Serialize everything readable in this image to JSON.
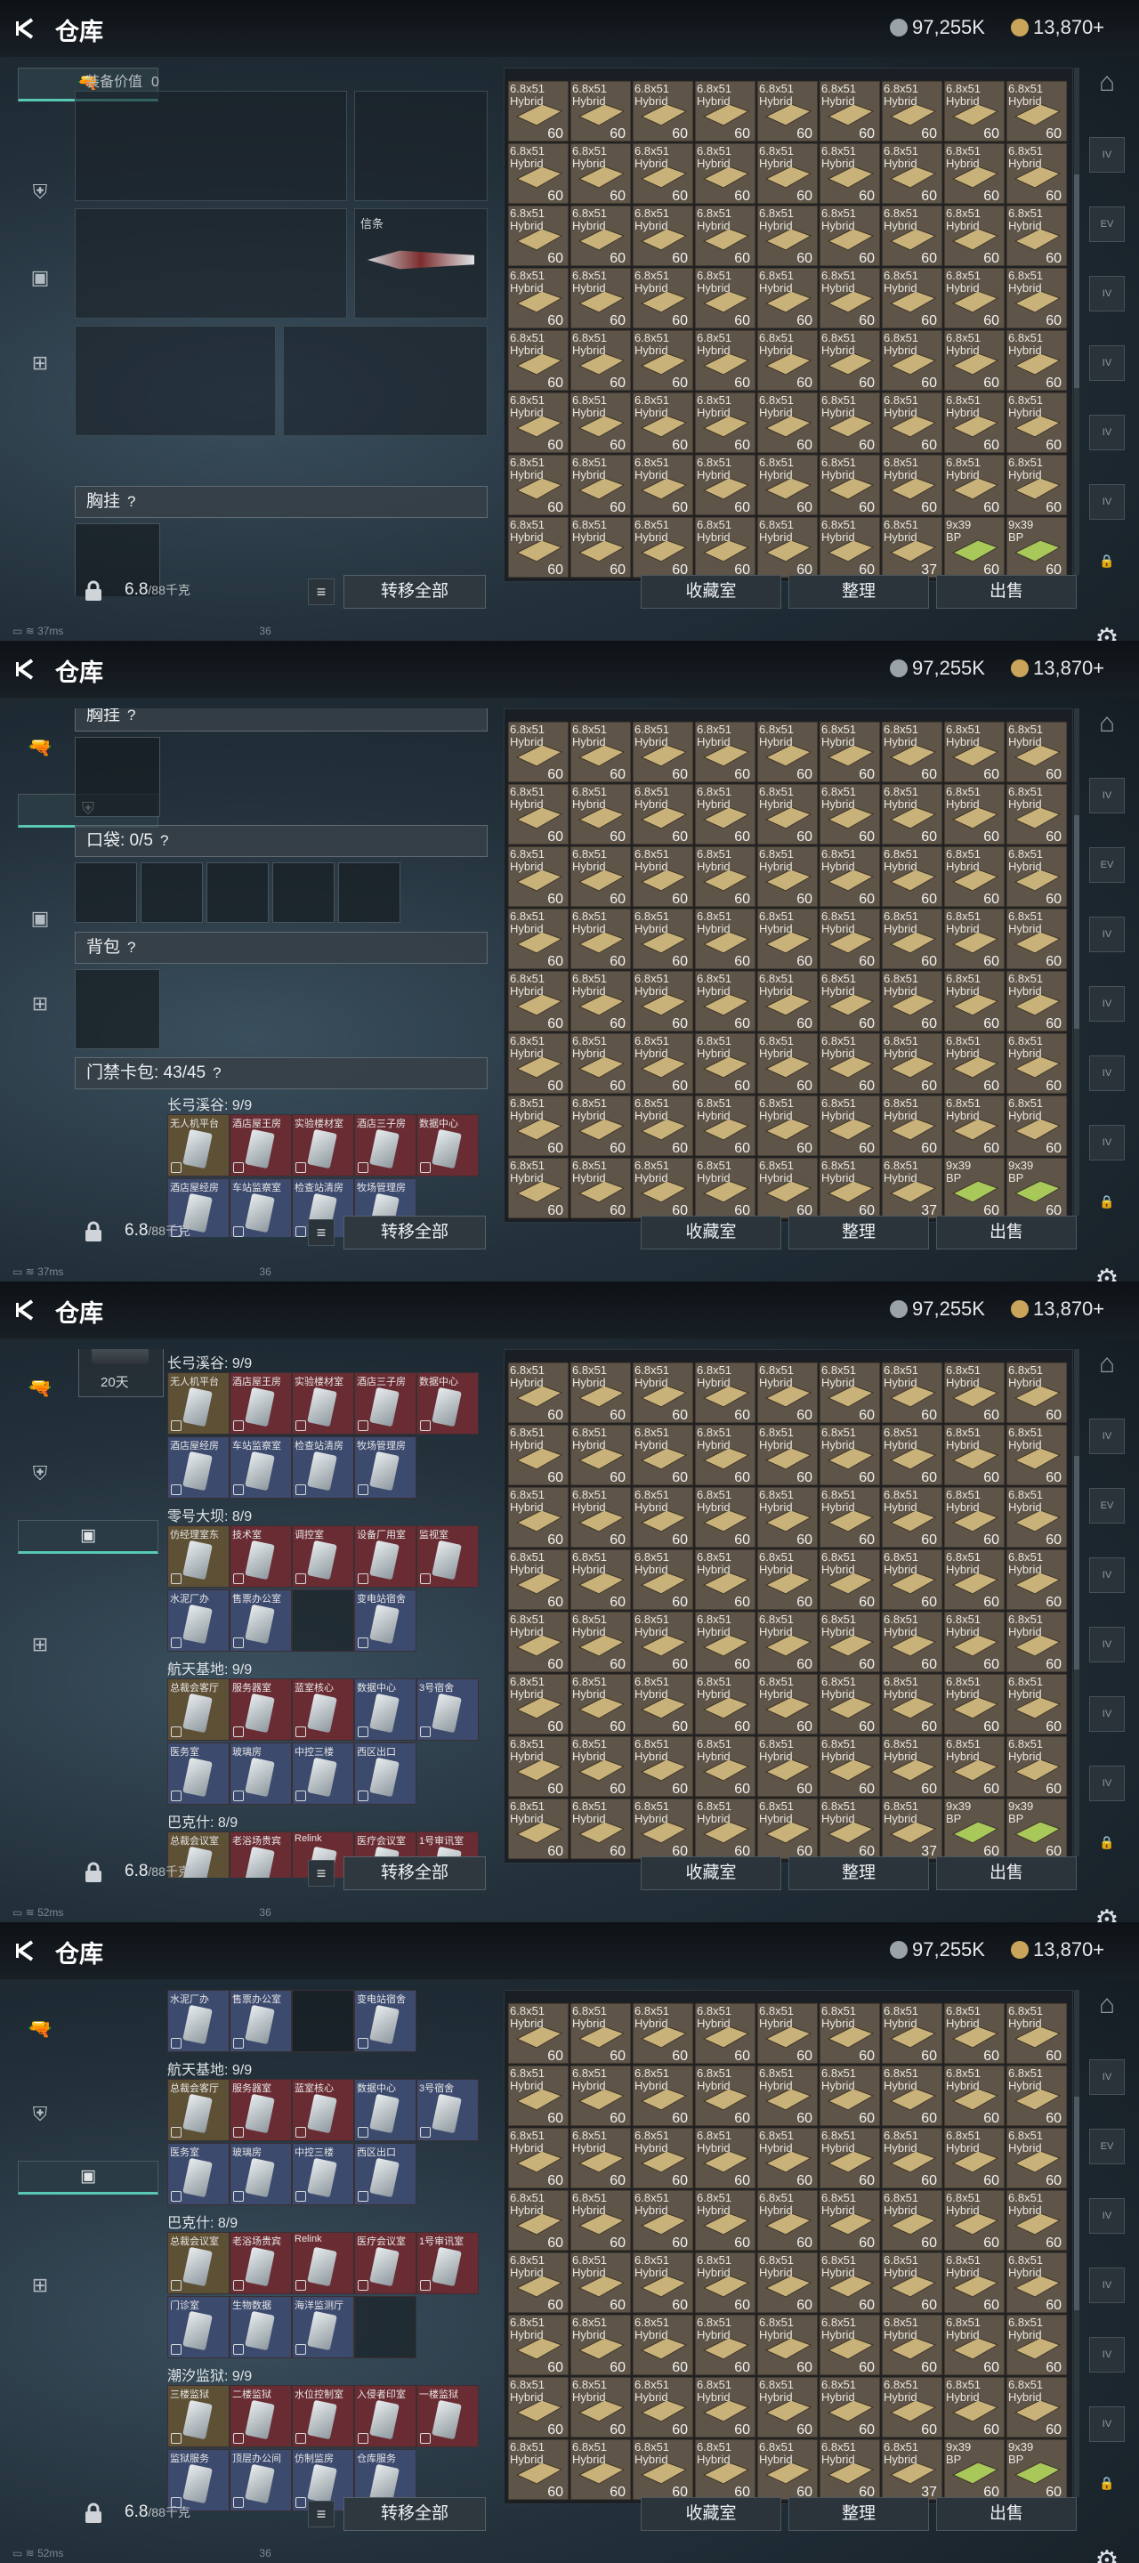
{
  "title": "仓库",
  "currency": {
    "silver": "97,255K",
    "gold": "13,870+"
  },
  "left_nav": [
    "weapon",
    "armor",
    "gear",
    "case"
  ],
  "right_nav": [
    "stash-main",
    "tab-1",
    "tab-2",
    "tab-3",
    "tab-4",
    "tab-5",
    "tab-6",
    "lock",
    "settings"
  ],
  "right_tab_labels": [
    "IV",
    "EV",
    "IV",
    "IV",
    "IV",
    "IV"
  ],
  "equip": {
    "value_label": "装备价值",
    "value": "0",
    "melee_name": "信条"
  },
  "sections": {
    "chest": "胸挂",
    "pocket": "口袋: 0/5",
    "backpack": "背包",
    "keycase": "门禁卡包: 43/45",
    "help": "?"
  },
  "keycase": {
    "duration": "20天"
  },
  "keygroups": [
    {
      "name": "长弓溪谷: 9/9",
      "keys": [
        {
          "n": "无人机平台",
          "c": "gold"
        },
        {
          "n": "酒店屋王房",
          "c": "red"
        },
        {
          "n": "实验楼材室",
          "c": "red"
        },
        {
          "n": "酒店三子房",
          "c": "red"
        },
        {
          "n": "数据中心",
          "c": "red"
        },
        {
          "n": "酒店屋经房",
          "c": "blu"
        },
        {
          "n": "车站监察室",
          "c": "blu"
        },
        {
          "n": "检查站清房",
          "c": "blu"
        },
        {
          "n": "牧场管理房",
          "c": "blu"
        }
      ]
    },
    {
      "name": "零号大坝: 8/9",
      "keys": [
        {
          "n": "仿经理室东",
          "c": "gold"
        },
        {
          "n": "技术室",
          "c": "red"
        },
        {
          "n": "调控室",
          "c": "red"
        },
        {
          "n": "设备厂用室",
          "c": "red"
        },
        {
          "n": "监视室",
          "c": "red"
        },
        {
          "n": "水泥厂办",
          "c": "blu"
        },
        {
          "n": "售票办公室",
          "c": "blu"
        },
        {
          "n": "",
          "c": "emp"
        },
        {
          "n": "变电站宿舍",
          "c": "blu"
        }
      ]
    },
    {
      "name": "航天基地: 9/9",
      "keys": [
        {
          "n": "总裁会客厅",
          "c": "gold"
        },
        {
          "n": "服务器室",
          "c": "red"
        },
        {
          "n": "蓝室核心",
          "c": "red"
        },
        {
          "n": "数据中心",
          "c": "blu"
        },
        {
          "n": "3号宿舍",
          "c": "blu"
        },
        {
          "n": "医务室",
          "c": "blu"
        },
        {
          "n": "玻璃房",
          "c": "blu"
        },
        {
          "n": "中控三楼",
          "c": "blu"
        },
        {
          "n": "西区出口",
          "c": "blu"
        }
      ]
    },
    {
      "name": "巴克什: 8/9",
      "keys": [
        {
          "n": "总裁会议室",
          "c": "gold"
        },
        {
          "n": "老浴场贵宾",
          "c": "red"
        },
        {
          "n": "Relink",
          "c": "red"
        },
        {
          "n": "医疗会议室",
          "c": "red"
        },
        {
          "n": "1号审讯室",
          "c": "red"
        },
        {
          "n": "门诊室",
          "c": "blu"
        },
        {
          "n": "生物数据",
          "c": "blu"
        },
        {
          "n": "海洋监测厅",
          "c": "blu"
        },
        {
          "n": "",
          "c": "emp"
        }
      ]
    },
    {
      "name": "潮汐监狱: 9/9",
      "keys": [
        {
          "n": "三楼监狱",
          "c": "gold"
        },
        {
          "n": "二楼监狱",
          "c": "red"
        },
        {
          "n": "水位控制室",
          "c": "red"
        },
        {
          "n": "入侵者印室",
          "c": "red"
        },
        {
          "n": "一楼监狱",
          "c": "red"
        },
        {
          "n": "监狱服务",
          "c": "blu"
        },
        {
          "n": "顶层办公间",
          "c": "blu"
        },
        {
          "n": "仿制监房",
          "c": "blu"
        },
        {
          "n": "仓库服务",
          "c": "blu"
        }
      ]
    }
  ],
  "weight": {
    "value": "6.8",
    "max": "/88千克"
  },
  "buttons": {
    "transfer": "转移全部",
    "collect": "收藏室",
    "organize": "整理",
    "sell": "出售"
  },
  "stash": {
    "rows": 8,
    "cols": 9,
    "ammo_label": "6.8x51",
    "ammo_sub": "Hybrid",
    "ammo_count": "60",
    "last_row": [
      {
        "label": "6.8x51",
        "count": "60"
      },
      {
        "label": "6.8x51",
        "count": "60"
      },
      {
        "label": "6.8x51",
        "count": "60"
      },
      {
        "label": "6.8x51",
        "count": "60"
      },
      {
        "label": "6.8x51",
        "count": "60"
      },
      {
        "label": "6.8x51",
        "count": "60"
      },
      {
        "label": "6.8x51",
        "count": "37"
      },
      {
        "label": "9x39",
        "sub": "BP",
        "count": "60"
      },
      {
        "label": "9x39",
        "sub": "BP",
        "count": "60"
      }
    ]
  },
  "status": {
    "ping_a": "37ms",
    "ping_b": "52ms",
    "fps": "36"
  },
  "colors": {
    "accent": "#59c9b4",
    "key_red": "#6a2c33",
    "key_blue": "#3c4a6e",
    "ammo_tile": "#5e5448"
  }
}
